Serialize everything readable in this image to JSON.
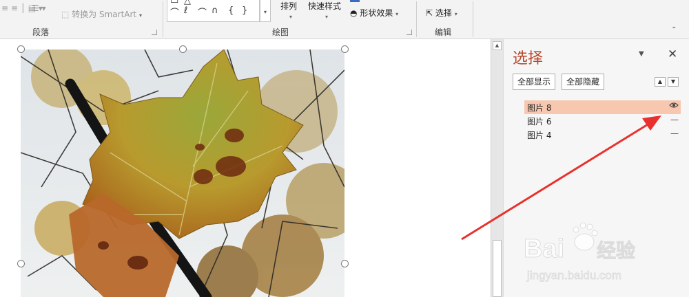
{
  "ribbon": {
    "groups": {
      "paragraph": "段落",
      "drawing": "绘图",
      "editing": "编辑"
    },
    "paragraph": {
      "smartart_label": "转换为 SmartArt",
      "dropdown_arrow": "▾"
    },
    "drawing": {
      "shape_glyphs_row1": [
        "▭",
        "△",
        "⌐",
        "⟋",
        "⬦"
      ],
      "shape_glyphs_row2": [
        "⌒",
        "ℓ",
        "⌒",
        "∩",
        "{",
        "}",
        "☆"
      ],
      "arrange_label": "排列",
      "quick_styles_label": "快速样式",
      "shape_effects_label": "形状效果"
    },
    "editing": {
      "select_label": "选择"
    }
  },
  "pane": {
    "title": "选择",
    "show_all": "全部显示",
    "hide_all": "全部隐藏",
    "items": [
      {
        "name": "图片 8",
        "visibility_icon": "eye-icon",
        "selected": true,
        "vis_glyph": "👁"
      },
      {
        "name": "图片 6",
        "visibility_icon": "hidden-dash-icon",
        "selected": false,
        "vis_glyph": "—"
      },
      {
        "name": "图片 4",
        "visibility_icon": "hidden-dash-icon",
        "selected": false,
        "vis_glyph": "—"
      }
    ],
    "accent_color": "#b7472a"
  },
  "watermark": {
    "brand": "Baidu",
    "suffix": "经验",
    "url": "jingyan.baidu.com"
  },
  "annotation_color": "#e8312e"
}
